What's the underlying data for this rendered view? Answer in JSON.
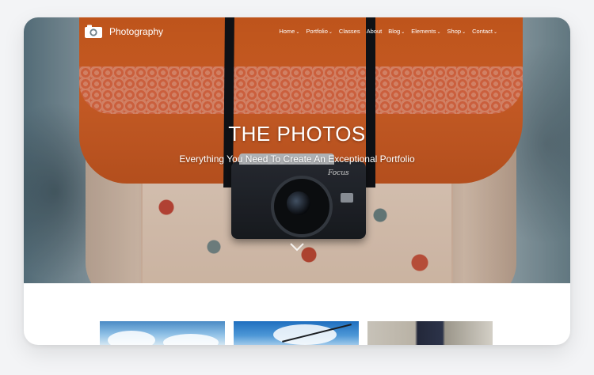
{
  "header": {
    "logo_text": "Photography",
    "logo_icon": "camera-icon"
  },
  "nav": {
    "items": [
      {
        "label": "Home",
        "has_dropdown": true
      },
      {
        "label": "Portfolio",
        "has_dropdown": true
      },
      {
        "label": "Classes",
        "has_dropdown": false
      },
      {
        "label": "About",
        "has_dropdown": false
      },
      {
        "label": "Blog",
        "has_dropdown": true
      },
      {
        "label": "Elements",
        "has_dropdown": true
      },
      {
        "label": "Shop",
        "has_dropdown": true
      },
      {
        "label": "Contact",
        "has_dropdown": true
      }
    ],
    "dropdown_glyph": "⌄"
  },
  "hero": {
    "title": "THE PHOTOS",
    "subtitle": "Everything You Need To Create An Exceptional Portfolio",
    "scroll_icon": "chevron-down-icon",
    "camera_brand": "Focus"
  },
  "colors": {
    "frame_background": "#ffffff",
    "page_background": "#f3f4f6",
    "nav_text": "#ffffff",
    "hero_text": "#ffffff"
  }
}
